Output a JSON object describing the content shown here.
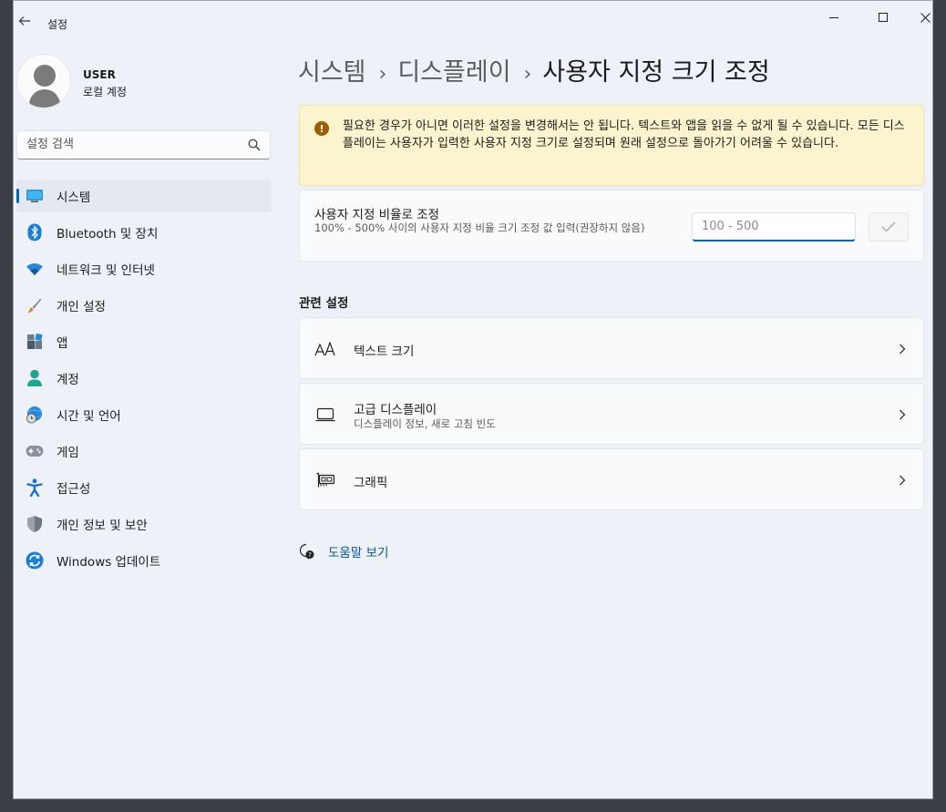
{
  "window": {
    "title": "설정"
  },
  "user": {
    "name": "USER",
    "account_type": "로컬 계정"
  },
  "search": {
    "placeholder": "설정 검색"
  },
  "sidebar": {
    "items": [
      {
        "label": "시스템",
        "icon": "system-icon",
        "selected": true
      },
      {
        "label": "Bluetooth 및 장치",
        "icon": "bluetooth-icon"
      },
      {
        "label": "네트워크 및 인터넷",
        "icon": "wifi-icon"
      },
      {
        "label": "개인 설정",
        "icon": "brush-icon"
      },
      {
        "label": "앱",
        "icon": "apps-icon"
      },
      {
        "label": "계정",
        "icon": "account-icon"
      },
      {
        "label": "시간 및 언어",
        "icon": "globe-clock-icon"
      },
      {
        "label": "게임",
        "icon": "gamepad-icon"
      },
      {
        "label": "접근성",
        "icon": "accessibility-icon"
      },
      {
        "label": "개인 정보 및 보안",
        "icon": "shield-icon"
      },
      {
        "label": "Windows 업데이트",
        "icon": "update-icon"
      }
    ]
  },
  "breadcrumb": {
    "parts": [
      "시스템",
      "디스플레이"
    ],
    "current": "사용자 지정 크기 조정",
    "separator": "›"
  },
  "warning": {
    "text": "필요한 경우가 아니면 이러한 설정을 변경해서는 안 됩니다. 텍스트와 앱을 읽을 수 없게 될 수 있습니다. 모든 디스플레이는 사용자가 입력한 사용자 지정 크기로 설정되며 원래 설정으로 돌아가기 어려울 수 있습니다.",
    "icon": "!"
  },
  "custom_scale": {
    "title": "사용자 지정 비율로 조정",
    "description": "100% - 500% 사이의 사용자 지정 비율 크기 조정 값 입력(권장하지 않음)",
    "input_value": "",
    "input_placeholder": "100 - 500"
  },
  "related": {
    "heading": "관련 설정",
    "items": [
      {
        "title": "텍스트 크기",
        "subtitle": "",
        "icon": "text-size-icon"
      },
      {
        "title": "고급 디스플레이",
        "subtitle": "디스플레이 정보, 새로 고침 빈도",
        "icon": "monitor-icon"
      },
      {
        "title": "그래픽",
        "subtitle": "",
        "icon": "graphics-card-icon"
      }
    ]
  },
  "help": {
    "label": "도움말 보기"
  },
  "colors": {
    "accent": "#0067c0",
    "warning_bg": "#fcf4ce",
    "warning_icon": "#9d5d00",
    "link": "#0052a3"
  }
}
